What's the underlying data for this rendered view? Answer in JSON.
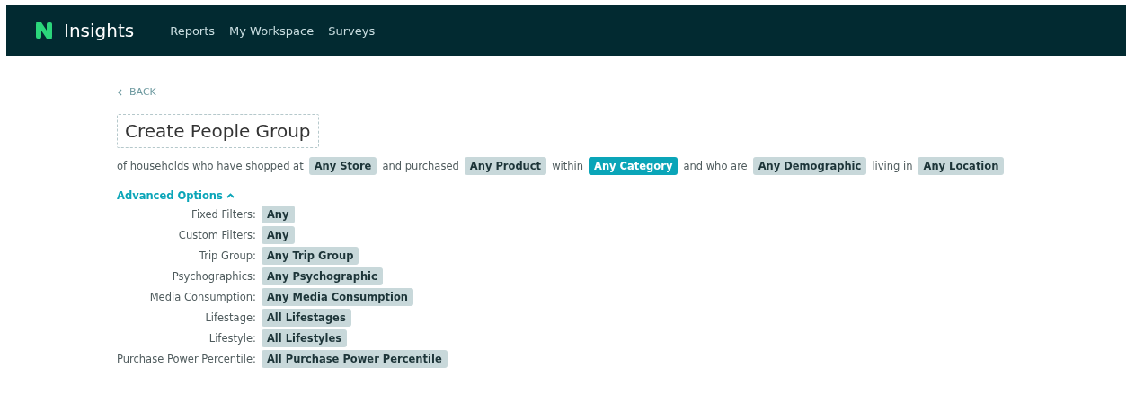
{
  "nav": {
    "brand": "Insights",
    "links": [
      "Reports",
      "My Workspace",
      "Surveys"
    ]
  },
  "back": "BACK",
  "title": "Create People Group",
  "sentence": [
    {
      "kind": "text",
      "text": "of households who have shopped at"
    },
    {
      "kind": "chip",
      "text": "Any Store",
      "selected": false
    },
    {
      "kind": "text",
      "text": "and purchased"
    },
    {
      "kind": "chip",
      "text": "Any Product",
      "selected": false
    },
    {
      "kind": "text",
      "text": "within"
    },
    {
      "kind": "chip",
      "text": "Any Category",
      "selected": true
    },
    {
      "kind": "text",
      "text": "and who are"
    },
    {
      "kind": "chip",
      "text": "Any Demographic",
      "selected": false
    },
    {
      "kind": "text",
      "text": "living in"
    },
    {
      "kind": "chip",
      "text": "Any Location",
      "selected": false
    }
  ],
  "advanced": {
    "label": "Advanced Options",
    "expanded": true,
    "filters": [
      {
        "label": "Fixed Filters:",
        "value": "Any"
      },
      {
        "label": "Custom Filters:",
        "value": "Any"
      },
      {
        "label": "Trip Group:",
        "value": "Any Trip Group"
      },
      {
        "label": "Psychographics:",
        "value": "Any Psychographic"
      },
      {
        "label": "Media Consumption:",
        "value": "Any Media Consumption"
      },
      {
        "label": "Lifestage:",
        "value": "All Lifestages"
      },
      {
        "label": "Lifestyle:",
        "value": "All Lifestyles"
      },
      {
        "label": "Purchase Power Percentile:",
        "value": "All Purchase Power Percentile"
      }
    ]
  }
}
